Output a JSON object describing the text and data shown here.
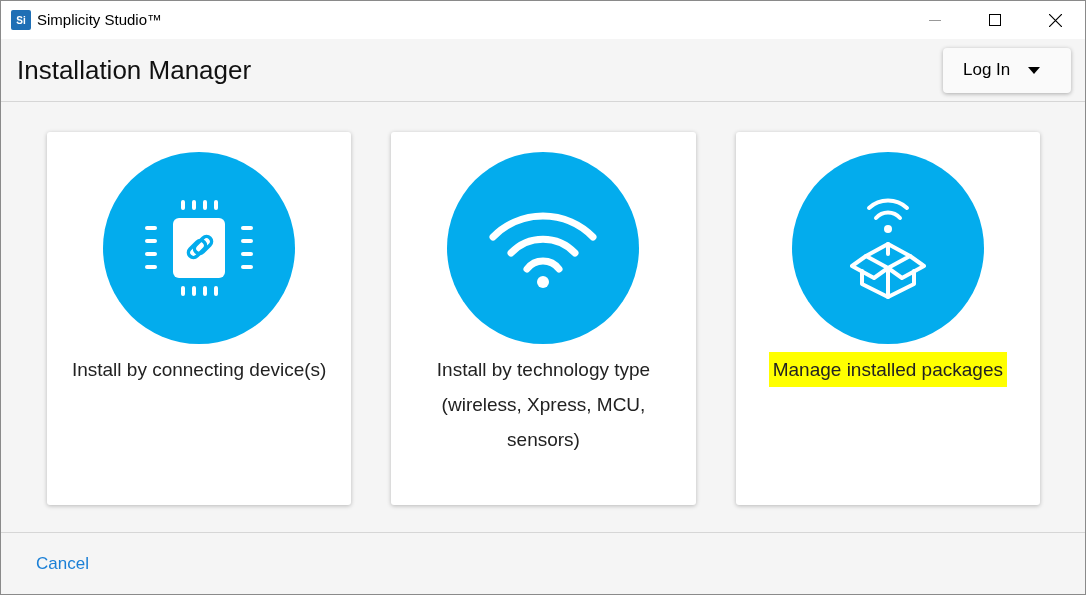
{
  "window": {
    "logo": "Si",
    "title": "Simplicity Studio™"
  },
  "header": {
    "title": "Installation Manager",
    "login_button": "Log In"
  },
  "cards": [
    {
      "kind": "chip",
      "label": "Install by connecting device(s)",
      "highlighted": false
    },
    {
      "kind": "wifi",
      "label": "Install by technology type (wireless, Xpress, MCU, sensors)",
      "highlighted": false
    },
    {
      "kind": "package",
      "label": "Manage installed packages",
      "highlighted": true
    }
  ],
  "footer": {
    "cancel": "Cancel"
  }
}
